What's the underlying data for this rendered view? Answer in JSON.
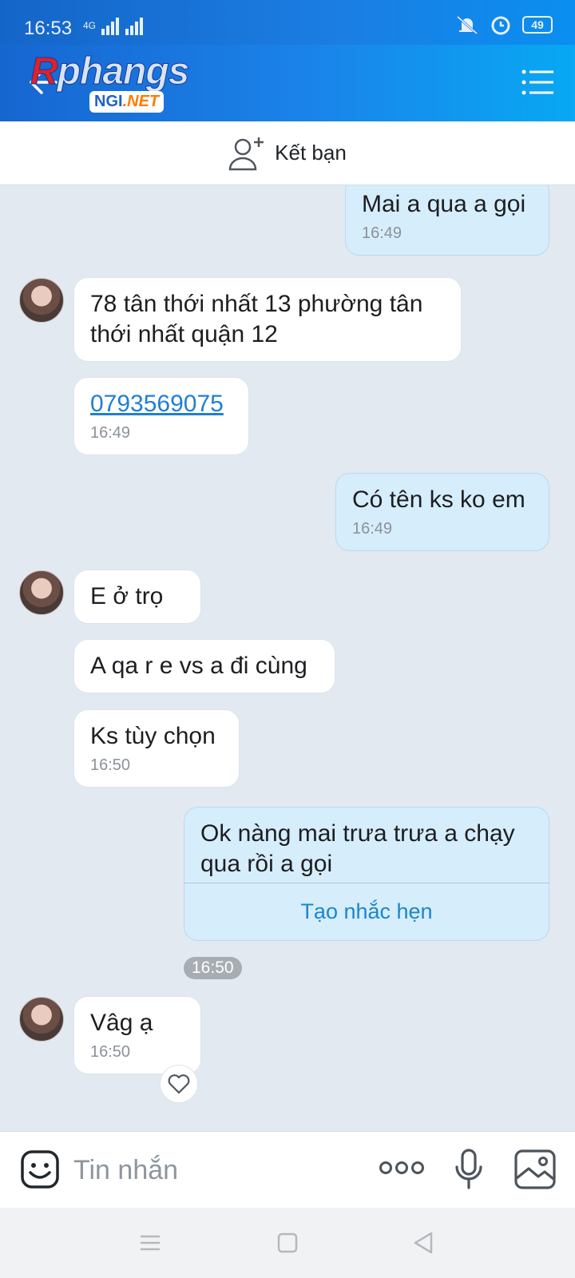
{
  "status_bar": {
    "time": "16:53",
    "network": "4G",
    "battery": "49"
  },
  "header": {
    "logo_main_r": "R",
    "logo_main_rest": "phangs",
    "logo_sub_ngi": "NGI",
    "logo_sub_net": ".NET"
  },
  "friend_bar": {
    "label": "Kết bạn"
  },
  "messages": [
    {
      "side": "out",
      "text": "Mai a qua a gọi",
      "time": "16:49"
    },
    {
      "side": "in",
      "text": "78 tân thới nhất 13 phường tân thới nhất quận 12"
    },
    {
      "side": "in",
      "text": "0793569075",
      "time": "16:49"
    },
    {
      "side": "out",
      "text": "Có tên ks ko em",
      "time": "16:49"
    },
    {
      "side": "in",
      "text": "E ở trọ"
    },
    {
      "side": "in",
      "text": "A qa r e vs a đi cùng"
    },
    {
      "side": "in",
      "text": "Ks tùy chọn",
      "time": "16:50"
    },
    {
      "side": "out",
      "text": "Ok nàng mai trưa trưa a chạy qua rồi a gọi",
      "action": "Tạo nhắc hẹn",
      "time": "16:50"
    },
    {
      "side": "in",
      "text": "Vâg ạ",
      "time": "16:50"
    }
  ],
  "input": {
    "placeholder": "Tin nhắn"
  },
  "colors": {
    "accent": "#1a84ea",
    "out_bubble": "#d6edfb",
    "link": "#1f7fd6",
    "chat_bg": "#e2e9f1"
  }
}
